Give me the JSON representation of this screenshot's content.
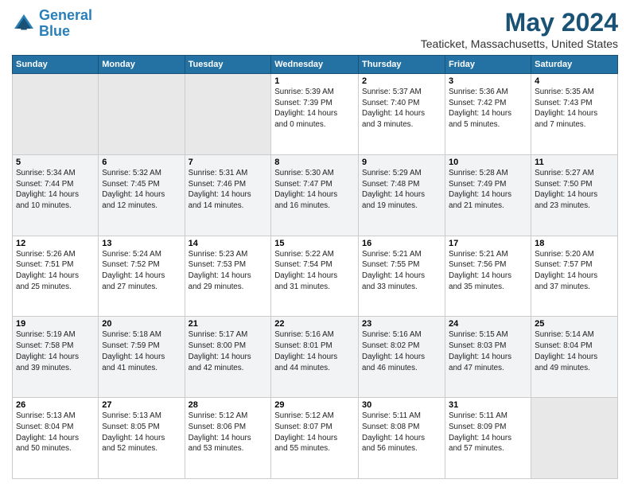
{
  "header": {
    "logo_line1": "General",
    "logo_line2": "Blue",
    "month_title": "May 2024",
    "location": "Teaticket, Massachusetts, United States"
  },
  "days_of_week": [
    "Sunday",
    "Monday",
    "Tuesday",
    "Wednesday",
    "Thursday",
    "Friday",
    "Saturday"
  ],
  "weeks": [
    [
      {
        "day": "",
        "info": ""
      },
      {
        "day": "",
        "info": ""
      },
      {
        "day": "",
        "info": ""
      },
      {
        "day": "1",
        "info": "Sunrise: 5:39 AM\nSunset: 7:39 PM\nDaylight: 14 hours\nand 0 minutes."
      },
      {
        "day": "2",
        "info": "Sunrise: 5:37 AM\nSunset: 7:40 PM\nDaylight: 14 hours\nand 3 minutes."
      },
      {
        "day": "3",
        "info": "Sunrise: 5:36 AM\nSunset: 7:42 PM\nDaylight: 14 hours\nand 5 minutes."
      },
      {
        "day": "4",
        "info": "Sunrise: 5:35 AM\nSunset: 7:43 PM\nDaylight: 14 hours\nand 7 minutes."
      }
    ],
    [
      {
        "day": "5",
        "info": "Sunrise: 5:34 AM\nSunset: 7:44 PM\nDaylight: 14 hours\nand 10 minutes."
      },
      {
        "day": "6",
        "info": "Sunrise: 5:32 AM\nSunset: 7:45 PM\nDaylight: 14 hours\nand 12 minutes."
      },
      {
        "day": "7",
        "info": "Sunrise: 5:31 AM\nSunset: 7:46 PM\nDaylight: 14 hours\nand 14 minutes."
      },
      {
        "day": "8",
        "info": "Sunrise: 5:30 AM\nSunset: 7:47 PM\nDaylight: 14 hours\nand 16 minutes."
      },
      {
        "day": "9",
        "info": "Sunrise: 5:29 AM\nSunset: 7:48 PM\nDaylight: 14 hours\nand 19 minutes."
      },
      {
        "day": "10",
        "info": "Sunrise: 5:28 AM\nSunset: 7:49 PM\nDaylight: 14 hours\nand 21 minutes."
      },
      {
        "day": "11",
        "info": "Sunrise: 5:27 AM\nSunset: 7:50 PM\nDaylight: 14 hours\nand 23 minutes."
      }
    ],
    [
      {
        "day": "12",
        "info": "Sunrise: 5:26 AM\nSunset: 7:51 PM\nDaylight: 14 hours\nand 25 minutes."
      },
      {
        "day": "13",
        "info": "Sunrise: 5:24 AM\nSunset: 7:52 PM\nDaylight: 14 hours\nand 27 minutes."
      },
      {
        "day": "14",
        "info": "Sunrise: 5:23 AM\nSunset: 7:53 PM\nDaylight: 14 hours\nand 29 minutes."
      },
      {
        "day": "15",
        "info": "Sunrise: 5:22 AM\nSunset: 7:54 PM\nDaylight: 14 hours\nand 31 minutes."
      },
      {
        "day": "16",
        "info": "Sunrise: 5:21 AM\nSunset: 7:55 PM\nDaylight: 14 hours\nand 33 minutes."
      },
      {
        "day": "17",
        "info": "Sunrise: 5:21 AM\nSunset: 7:56 PM\nDaylight: 14 hours\nand 35 minutes."
      },
      {
        "day": "18",
        "info": "Sunrise: 5:20 AM\nSunset: 7:57 PM\nDaylight: 14 hours\nand 37 minutes."
      }
    ],
    [
      {
        "day": "19",
        "info": "Sunrise: 5:19 AM\nSunset: 7:58 PM\nDaylight: 14 hours\nand 39 minutes."
      },
      {
        "day": "20",
        "info": "Sunrise: 5:18 AM\nSunset: 7:59 PM\nDaylight: 14 hours\nand 41 minutes."
      },
      {
        "day": "21",
        "info": "Sunrise: 5:17 AM\nSunset: 8:00 PM\nDaylight: 14 hours\nand 42 minutes."
      },
      {
        "day": "22",
        "info": "Sunrise: 5:16 AM\nSunset: 8:01 PM\nDaylight: 14 hours\nand 44 minutes."
      },
      {
        "day": "23",
        "info": "Sunrise: 5:16 AM\nSunset: 8:02 PM\nDaylight: 14 hours\nand 46 minutes."
      },
      {
        "day": "24",
        "info": "Sunrise: 5:15 AM\nSunset: 8:03 PM\nDaylight: 14 hours\nand 47 minutes."
      },
      {
        "day": "25",
        "info": "Sunrise: 5:14 AM\nSunset: 8:04 PM\nDaylight: 14 hours\nand 49 minutes."
      }
    ],
    [
      {
        "day": "26",
        "info": "Sunrise: 5:13 AM\nSunset: 8:04 PM\nDaylight: 14 hours\nand 50 minutes."
      },
      {
        "day": "27",
        "info": "Sunrise: 5:13 AM\nSunset: 8:05 PM\nDaylight: 14 hours\nand 52 minutes."
      },
      {
        "day": "28",
        "info": "Sunrise: 5:12 AM\nSunset: 8:06 PM\nDaylight: 14 hours\nand 53 minutes."
      },
      {
        "day": "29",
        "info": "Sunrise: 5:12 AM\nSunset: 8:07 PM\nDaylight: 14 hours\nand 55 minutes."
      },
      {
        "day": "30",
        "info": "Sunrise: 5:11 AM\nSunset: 8:08 PM\nDaylight: 14 hours\nand 56 minutes."
      },
      {
        "day": "31",
        "info": "Sunrise: 5:11 AM\nSunset: 8:09 PM\nDaylight: 14 hours\nand 57 minutes."
      },
      {
        "day": "",
        "info": ""
      }
    ]
  ]
}
